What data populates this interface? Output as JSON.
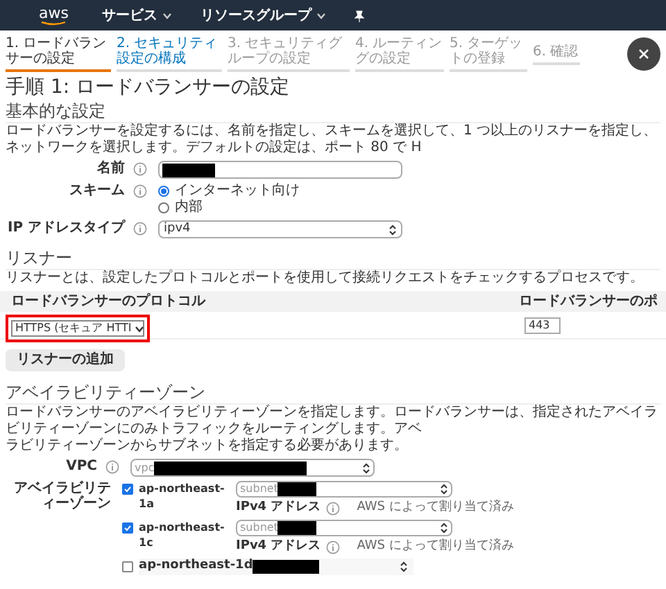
{
  "nav": {
    "logo": "aws",
    "items": [
      {
        "label": "サービス",
        "dropdown": true
      },
      {
        "label": "リソースグループ",
        "dropdown": true
      }
    ]
  },
  "steps": [
    {
      "label": "1. ロードバランサーの設定",
      "selected": true,
      "enabled": true
    },
    {
      "label": "2. セキュリティ設定の構成",
      "selected": false,
      "enabled": true
    },
    {
      "label": "3. セキュリティグループの設定",
      "selected": false,
      "enabled": false
    },
    {
      "label": "4. ルーティングの設定",
      "selected": false,
      "enabled": false
    },
    {
      "label": "5. ターゲットの登録",
      "selected": false,
      "enabled": false
    },
    {
      "label": "6. 確認",
      "selected": false,
      "enabled": false
    }
  ],
  "title": "手順 1: ロードバランサーの設定",
  "basic": {
    "heading": "基本的な設定",
    "description": "ロードバランサーを設定するには、名前を指定し、スキームを選択して、1 つ以上のリスナーを指定し、ネットワークを選択します。デフォルトの設定は、ポート 80 で H",
    "name": {
      "label": "名前",
      "redacted": true
    },
    "scheme": {
      "label": "スキーム",
      "options": [
        {
          "label": "インターネット向け",
          "selected": true
        },
        {
          "label": "内部",
          "selected": false
        }
      ]
    },
    "ip_type": {
      "label": "IP アドレスタイプ",
      "value": "ipv4"
    }
  },
  "listeners": {
    "heading": "リスナー",
    "description": "リスナーとは、設定したプロトコルとポートを使用して接続リクエストをチェックするプロセスです。",
    "columns": [
      "ロードバランサーのプロトコル",
      "ロードバランサーのポ"
    ],
    "rows": [
      {
        "protocol": "HTTPS (セキュア HTTI",
        "port": "443",
        "highlighted": true
      }
    ],
    "add_button": "リスナーの追加"
  },
  "zones": {
    "heading": "アベイラビリティーゾーン",
    "description_lines": [
      "ロードバランサーのアベイラビリティーゾーンを指定します。ロードバランサーは、指定されたアベイラビリティーゾーンにのみトラフィックをルーティングします。アベ",
      "ラビリティーゾーンからサブネットを指定する必要があります。"
    ],
    "vpc": {
      "label": "VPC",
      "value": "vpc",
      "redacted": true
    },
    "label": "アベイラビリティーゾーン",
    "items": [
      {
        "name": "ap-northeast-1a",
        "checked": true,
        "subnet": "subnet",
        "redacted": true,
        "ipv4_label": "IPv4 アドレス",
        "ipv4_value": "AWS によって割り当て済み"
      },
      {
        "name": "ap-northeast-1c",
        "checked": true,
        "subnet": "subnet",
        "redacted": true,
        "ipv4_label": "IPv4 アドレス",
        "ipv4_value": "AWS によって割り当て済み"
      },
      {
        "name": "ap-northeast-1d",
        "checked": false,
        "redacted": true
      }
    ]
  }
}
